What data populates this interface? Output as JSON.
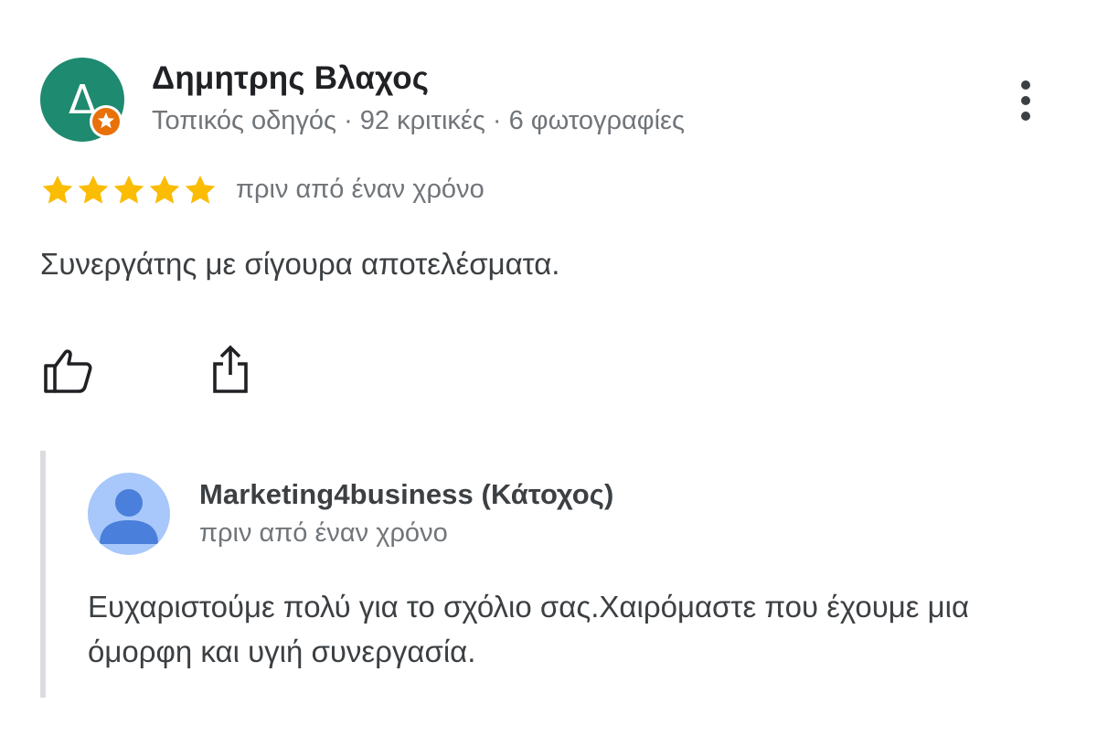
{
  "review": {
    "reviewer": {
      "initial": "Δ",
      "name": "Δημητρης Βλαχος",
      "meta": "Τοπικός οδηγός · 92 κριτικές · 6 φωτογραφίες",
      "avatar_color": "#1e8a6f",
      "badge_icon": "local-guide-badge-icon",
      "badge_color": "#e8710a"
    },
    "rating": 5,
    "rating_max": 5,
    "star_color": "#fbbc04",
    "time": "πριν από έναν χρόνο",
    "text": "Συνεργάτης με σίγουρα αποτελέσματα.",
    "actions": {
      "like_icon": "thumbs-up-icon",
      "share_icon": "share-icon",
      "more_icon": "more-vert-icon"
    }
  },
  "response": {
    "owner_name": "Marketing4business (Κάτοχος)",
    "time": "πριν από έναν χρόνο",
    "text": "Ευχαριστούμε πολύ για το σχόλιο σας.Χαιρόμαστε που έχουμε μια όμορφη και υγιή συνεργασία.",
    "avatar_icon": "default-profile-icon",
    "avatar_bg": "#a8c7fa",
    "avatar_fg": "#4a7fdb"
  }
}
